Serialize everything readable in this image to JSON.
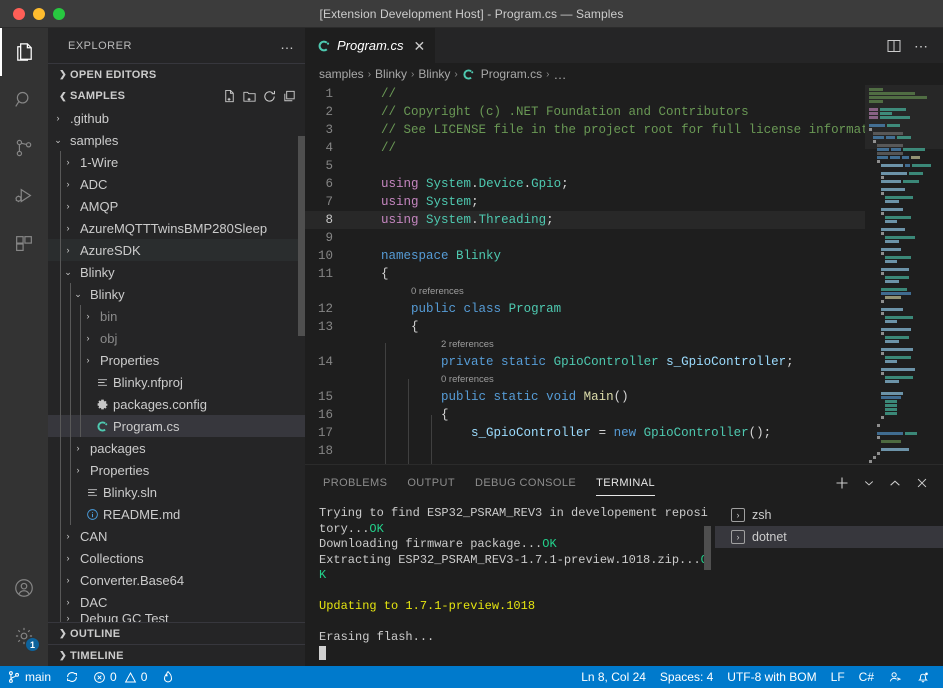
{
  "titlebar": {
    "title": "[Extension Development Host] - Program.cs — Samples",
    "traffic": [
      "close-red",
      "minimize-yellow",
      "maximize-green"
    ]
  },
  "activitybar": {
    "items": [
      {
        "name": "explorer",
        "icon": "files-icon",
        "active": true
      },
      {
        "name": "search",
        "icon": "search-icon",
        "active": false
      },
      {
        "name": "source-control",
        "icon": "source-control-icon",
        "active": false
      },
      {
        "name": "run-and-debug",
        "icon": "run-debug-icon",
        "active": false
      },
      {
        "name": "extensions",
        "icon": "extensions-icon",
        "active": false
      }
    ],
    "bottom": [
      {
        "name": "accounts",
        "icon": "account-icon",
        "badge": ""
      },
      {
        "name": "manage",
        "icon": "gear-icon",
        "badge": "1"
      }
    ]
  },
  "sidebar": {
    "title": "EXPLORER",
    "more_label": "…",
    "sections": [
      {
        "label": "OPEN EDITORS",
        "expanded": false
      },
      {
        "label": "SAMPLES",
        "expanded": true
      }
    ],
    "samples_actions": [
      "new-file-icon",
      "new-folder-icon",
      "refresh-icon",
      "collapse-all-icon"
    ],
    "tree": [
      {
        "label": ".github",
        "depth": 1,
        "type": "folder",
        "expanded": false,
        "state": "none"
      },
      {
        "label": "samples",
        "depth": 1,
        "type": "folder",
        "expanded": true,
        "state": "none"
      },
      {
        "label": "1-Wire",
        "depth": 2,
        "type": "folder",
        "expanded": false,
        "state": "none"
      },
      {
        "label": "ADC",
        "depth": 2,
        "type": "folder",
        "expanded": false,
        "state": "none"
      },
      {
        "label": "AMQP",
        "depth": 2,
        "type": "folder",
        "expanded": false,
        "state": "none"
      },
      {
        "label": "AzureMQTTTwinsBMP280Sleep",
        "depth": 2,
        "type": "folder",
        "expanded": false,
        "state": "none"
      },
      {
        "label": "AzureSDK",
        "depth": 2,
        "type": "folder",
        "expanded": false,
        "state": "hover"
      },
      {
        "label": "Blinky",
        "depth": 2,
        "type": "folder",
        "expanded": true,
        "state": "none"
      },
      {
        "label": "Blinky",
        "depth": 3,
        "type": "folder",
        "expanded": true,
        "state": "none"
      },
      {
        "label": "bin",
        "depth": 4,
        "type": "folder",
        "expanded": false,
        "state": "dim"
      },
      {
        "label": "obj",
        "depth": 4,
        "type": "folder",
        "expanded": false,
        "state": "dim"
      },
      {
        "label": "Properties",
        "depth": 4,
        "type": "folder",
        "expanded": false,
        "state": "none"
      },
      {
        "label": "Blinky.nfproj",
        "depth": 4,
        "type": "file",
        "icon": "lines-icon",
        "state": "none"
      },
      {
        "label": "packages.config",
        "depth": 4,
        "type": "file",
        "icon": "gear-file-icon",
        "state": "none"
      },
      {
        "label": "Program.cs",
        "depth": 4,
        "type": "file",
        "icon": "csharp-icon",
        "state": "selected"
      },
      {
        "label": "packages",
        "depth": 3,
        "type": "folder",
        "expanded": false,
        "state": "none"
      },
      {
        "label": "Properties",
        "depth": 3,
        "type": "folder",
        "expanded": false,
        "state": "none"
      },
      {
        "label": "Blinky.sln",
        "depth": 3,
        "type": "file",
        "icon": "lines-icon",
        "state": "none"
      },
      {
        "label": "README.md",
        "depth": 3,
        "type": "file",
        "icon": "info-icon",
        "state": "none"
      },
      {
        "label": "CAN",
        "depth": 2,
        "type": "folder",
        "expanded": false,
        "state": "none"
      },
      {
        "label": "Collections",
        "depth": 2,
        "type": "folder",
        "expanded": false,
        "state": "none"
      },
      {
        "label": "Converter.Base64",
        "depth": 2,
        "type": "folder",
        "expanded": false,
        "state": "none"
      },
      {
        "label": "DAC",
        "depth": 2,
        "type": "folder",
        "expanded": false,
        "state": "none"
      },
      {
        "label": "Debug GC Test",
        "depth": 2,
        "type": "folder",
        "expanded": false,
        "state": "clipped"
      }
    ],
    "bottom_sections": [
      {
        "label": "OUTLINE"
      },
      {
        "label": "TIMELINE"
      }
    ]
  },
  "editor": {
    "tab": {
      "title": "Program.cs",
      "icon": "csharp-icon",
      "close_label": "✕",
      "preview": true
    },
    "tab_actions": [
      "split-editor-icon",
      "more-actions-icon"
    ],
    "breadcrumb": [
      "samples",
      "Blinky",
      "Blinky",
      "Program.cs",
      "…"
    ],
    "breadcrumb_file_icon": "csharp-icon",
    "cursor_line": 8,
    "lines": [
      {
        "n": 1,
        "tokens": [
          {
            "t": "    ",
            "c": "plain"
          },
          {
            "t": "//",
            "c": "comment"
          }
        ]
      },
      {
        "n": 2,
        "tokens": [
          {
            "t": "    ",
            "c": "plain"
          },
          {
            "t": "// Copyright (c) .NET Foundation and Contributors",
            "c": "comment"
          }
        ]
      },
      {
        "n": 3,
        "tokens": [
          {
            "t": "    ",
            "c": "plain"
          },
          {
            "t": "// See LICENSE file in the project root for full license information.",
            "c": "comment"
          }
        ]
      },
      {
        "n": 4,
        "tokens": [
          {
            "t": "    ",
            "c": "plain"
          },
          {
            "t": "//",
            "c": "comment"
          }
        ]
      },
      {
        "n": 5,
        "tokens": []
      },
      {
        "n": 6,
        "tokens": [
          {
            "t": "    ",
            "c": "plain"
          },
          {
            "t": "using",
            "c": "keyword"
          },
          {
            "t": " ",
            "c": "plain"
          },
          {
            "t": "System",
            "c": "ns"
          },
          {
            "t": ".",
            "c": "punct"
          },
          {
            "t": "Device",
            "c": "ns"
          },
          {
            "t": ".",
            "c": "punct"
          },
          {
            "t": "Gpio",
            "c": "ns"
          },
          {
            "t": ";",
            "c": "punct"
          }
        ]
      },
      {
        "n": 7,
        "tokens": [
          {
            "t": "    ",
            "c": "plain"
          },
          {
            "t": "using",
            "c": "keyword"
          },
          {
            "t": " ",
            "c": "plain"
          },
          {
            "t": "System",
            "c": "ns"
          },
          {
            "t": ";",
            "c": "punct"
          }
        ]
      },
      {
        "n": 8,
        "tokens": [
          {
            "t": "    ",
            "c": "plain"
          },
          {
            "t": "using",
            "c": "keyword"
          },
          {
            "t": " ",
            "c": "plain"
          },
          {
            "t": "System",
            "c": "ns"
          },
          {
            "t": ".",
            "c": "punct"
          },
          {
            "t": "Threading",
            "c": "type"
          },
          {
            "t": ";",
            "c": "punct"
          }
        ]
      },
      {
        "n": 9,
        "tokens": []
      },
      {
        "n": 10,
        "tokens": [
          {
            "t": "    ",
            "c": "plain"
          },
          {
            "t": "namespace",
            "c": "keyword2"
          },
          {
            "t": " ",
            "c": "plain"
          },
          {
            "t": "Blinky",
            "c": "ns"
          }
        ]
      },
      {
        "n": 11,
        "tokens": [
          {
            "t": "    ",
            "c": "plain"
          },
          {
            "t": "{",
            "c": "plain"
          }
        ]
      },
      {
        "n": 12,
        "tokens": [
          {
            "t": "        ",
            "c": "plain"
          },
          {
            "t": "public",
            "c": "keyword2"
          },
          {
            "t": " ",
            "c": "plain"
          },
          {
            "t": "class",
            "c": "keyword2"
          },
          {
            "t": " ",
            "c": "plain"
          },
          {
            "t": "Program",
            "c": "type"
          }
        ],
        "ref": "0 references"
      },
      {
        "n": 13,
        "tokens": [
          {
            "t": "        ",
            "c": "plain"
          },
          {
            "t": "{",
            "c": "plain"
          }
        ]
      },
      {
        "n": 14,
        "tokens": [
          {
            "t": "            ",
            "c": "plain"
          },
          {
            "t": "private",
            "c": "keyword2"
          },
          {
            "t": " ",
            "c": "plain"
          },
          {
            "t": "static",
            "c": "keyword2"
          },
          {
            "t": " ",
            "c": "plain"
          },
          {
            "t": "GpioController",
            "c": "type"
          },
          {
            "t": " ",
            "c": "plain"
          },
          {
            "t": "s_GpioController",
            "c": "field"
          },
          {
            "t": ";",
            "c": "plain"
          }
        ],
        "ref": "2 references"
      },
      {
        "n": 15,
        "tokens": [
          {
            "t": "            ",
            "c": "plain"
          },
          {
            "t": "public",
            "c": "keyword2"
          },
          {
            "t": " ",
            "c": "plain"
          },
          {
            "t": "static",
            "c": "keyword2"
          },
          {
            "t": " ",
            "c": "plain"
          },
          {
            "t": "void",
            "c": "keyword2"
          },
          {
            "t": " ",
            "c": "plain"
          },
          {
            "t": "Main",
            "c": "method"
          },
          {
            "t": "()",
            "c": "plain"
          }
        ],
        "ref": "0 references"
      },
      {
        "n": 16,
        "tokens": [
          {
            "t": "            ",
            "c": "plain"
          },
          {
            "t": "{",
            "c": "plain"
          }
        ]
      },
      {
        "n": 17,
        "tokens": [
          {
            "t": "                ",
            "c": "plain"
          },
          {
            "t": "s_GpioController",
            "c": "field"
          },
          {
            "t": " = ",
            "c": "plain"
          },
          {
            "t": "new",
            "c": "keyword2"
          },
          {
            "t": " ",
            "c": "plain"
          },
          {
            "t": "GpioController",
            "c": "type"
          },
          {
            "t": "();",
            "c": "plain"
          }
        ]
      },
      {
        "n": 18,
        "tokens": []
      }
    ]
  },
  "panel": {
    "tabs": [
      {
        "label": "PROBLEMS",
        "active": false
      },
      {
        "label": "OUTPUT",
        "active": false
      },
      {
        "label": "DEBUG CONSOLE",
        "active": false
      },
      {
        "label": "TERMINAL",
        "active": true
      }
    ],
    "actions": [
      "add-terminal-icon",
      "chevron-down-icon",
      "maximize-panel-icon",
      "close-panel-icon"
    ],
    "terminal_output": [
      [
        {
          "t": "Trying to find ESP32_PSRAM_REV3 in developement repository...",
          "c": "plain"
        },
        {
          "t": "OK",
          "c": "green"
        }
      ],
      [
        {
          "t": "Downloading firmware package...",
          "c": "plain"
        },
        {
          "t": "OK",
          "c": "green"
        }
      ],
      [
        {
          "t": "Extracting ESP32_PSRAM_REV3-1.7.1-preview.1018.zip...",
          "c": "plain"
        },
        {
          "t": "OK",
          "c": "green"
        }
      ],
      [],
      [
        {
          "t": "Updating to 1.7.1-preview.1018",
          "c": "yellow"
        }
      ],
      [],
      [
        {
          "t": "Erasing flash...",
          "c": "plain"
        }
      ]
    ],
    "terminals": [
      {
        "label": "zsh",
        "icon": "terminal-icon",
        "selected": false
      },
      {
        "label": "dotnet",
        "icon": "terminal-icon",
        "selected": true
      }
    ]
  },
  "statusbar": {
    "left": [
      {
        "name": "branch",
        "icon": "git-branch-icon",
        "label": "main"
      },
      {
        "name": "sync",
        "icon": "sync-icon",
        "label": ""
      },
      {
        "name": "problems",
        "icon": "error-warning-icon",
        "label": "0 ⚠ 0",
        "errors": "0",
        "warnings": "0"
      },
      {
        "name": "nanoframework",
        "icon": "flame-icon",
        "label": ""
      }
    ],
    "right": [
      {
        "name": "cursor-position",
        "label": "Ln 8, Col 24"
      },
      {
        "name": "indentation",
        "label": "Spaces: 4"
      },
      {
        "name": "encoding",
        "label": "UTF-8 with BOM"
      },
      {
        "name": "eol",
        "label": "LF"
      },
      {
        "name": "language-mode",
        "label": "C#"
      },
      {
        "name": "live-share",
        "icon": "live-share-icon",
        "label": ""
      },
      {
        "name": "notifications",
        "icon": "bell-icon",
        "label": ""
      }
    ],
    "background": "#007acc"
  },
  "colors": {
    "accent": "#007acc",
    "editor_bg": "#1e1e1e",
    "sidebar_bg": "#252526",
    "activitybar_bg": "#333333",
    "titlebar_bg": "#3c3c3c",
    "comment": "#6a9955",
    "keyword": "#c586c0",
    "keyword2": "#569cd6",
    "type": "#4ec9b0",
    "ns": "#4ec9b0",
    "method": "#dcdcaa",
    "field": "#9cdcfe",
    "terminal_green": "#23d18b",
    "terminal_yellow": "#e5e510"
  }
}
